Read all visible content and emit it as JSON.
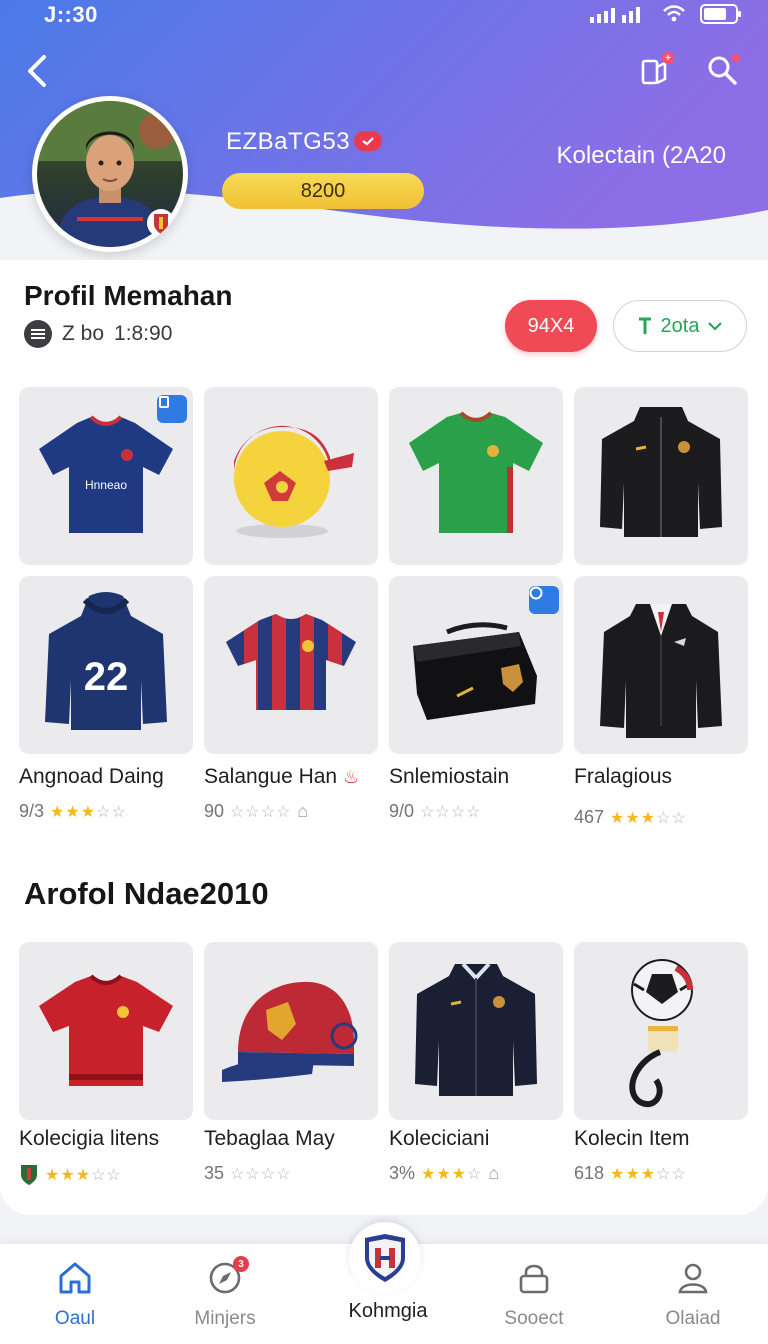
{
  "status_bar": {
    "time": "J::30"
  },
  "profile": {
    "username": "EZBaTG53",
    "points": "8200",
    "collection_year": "Kolectain (2A20"
  },
  "section1": {
    "title": "Profil Memahan",
    "stat_label": "Z bo",
    "stat_value": "1:8:90",
    "red_pill": "94X4",
    "select_value": "2ota"
  },
  "grid1": [
    {
      "icon": "navy-jersey",
      "badge": true,
      "badge_icon": "share-icon"
    },
    {
      "icon": "ball-cap"
    },
    {
      "icon": "green-jersey"
    },
    {
      "icon": "black-jacket"
    },
    {
      "icon": "navy-hoodie-22",
      "number": "22"
    },
    {
      "icon": "striped-jersey"
    },
    {
      "icon": "black-pouch",
      "badge": true,
      "badge_icon": "info-icon"
    },
    {
      "icon": "black-suit"
    }
  ],
  "grid1_labels": [
    {
      "name": "Angnoad Daing",
      "meta": "9/3",
      "rating": 3,
      "extra": ""
    },
    {
      "name": "Salangue Han",
      "meta": "90",
      "rating": 0,
      "extra": "home"
    },
    {
      "name": "Snlemiostain",
      "meta": "9/0",
      "rating": 0,
      "extra": ""
    },
    {
      "name": "Fralagious",
      "meta": "467",
      "rating": 3,
      "extra": ""
    }
  ],
  "section2": {
    "title": "Arofol Ndae2010"
  },
  "grid2": [
    {
      "icon": "red-jersey"
    },
    {
      "icon": "red-cap"
    },
    {
      "icon": "navy-jacket"
    },
    {
      "icon": "ball-keychain"
    }
  ],
  "grid2_labels": [
    {
      "name": "Kolecigia litens",
      "meta": "",
      "rating": 3,
      "extra": "badge"
    },
    {
      "name": "Tebaglaa May",
      "meta": "35",
      "rating": 0,
      "extra": ""
    },
    {
      "name": "Koleciciani",
      "meta": "3%",
      "rating": 3,
      "extra": "home"
    },
    {
      "name": "Kolecin Item",
      "meta": "618",
      "rating": 3,
      "extra": ""
    }
  ],
  "nav": {
    "home": "Oaul",
    "missions": "Minjers",
    "center": "Kohmgia",
    "score": "Sooect",
    "profile": "Olaiad",
    "missions_badge": "3"
  },
  "colors": {
    "header_start": "#4f7be8",
    "header_end": "#8d6fe6",
    "accent_red": "#ef4a55",
    "accent_gold": "#f0c034",
    "nav_active": "#2b6fd6"
  }
}
